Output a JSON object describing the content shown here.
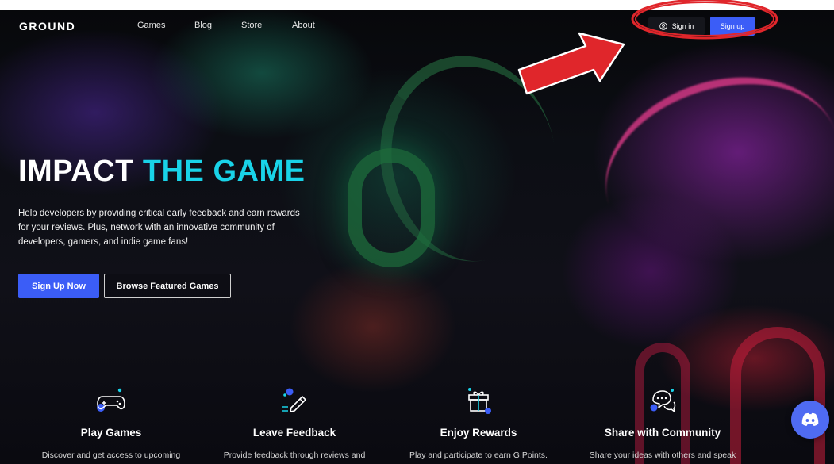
{
  "nav": {
    "logo": "GROUND",
    "links": [
      "Games",
      "Blog",
      "Store",
      "About"
    ],
    "signin_label": "Sign in",
    "signup_label": "Sign up"
  },
  "hero": {
    "title_white": "IMPACT",
    "title_cyan": "THE GAME",
    "description": "Help developers by providing critical early feedback and earn rewards for your reviews. Plus, network with an innovative community of developers, gamers, and indie game fans!",
    "primary_button": "Sign Up Now",
    "secondary_button": "Browse Featured Games"
  },
  "features": [
    {
      "title": "Play Games",
      "desc": "Discover and get access to upcoming",
      "icon": "gamepad-icon"
    },
    {
      "title": "Leave Feedback",
      "desc": "Provide feedback through reviews and",
      "icon": "pencil-icon"
    },
    {
      "title": "Enjoy Rewards",
      "desc": "Play and participate to earn G.Points.",
      "icon": "gift-icon"
    },
    {
      "title": "Share with Community",
      "desc": "Share your ideas with others and speak",
      "icon": "chat-icon"
    }
  ],
  "colors": {
    "accent_blue": "#3b5df7",
    "accent_cyan": "#19d3e8",
    "annotation_red": "#e0262b",
    "discord_blue": "#4f6bf2"
  }
}
